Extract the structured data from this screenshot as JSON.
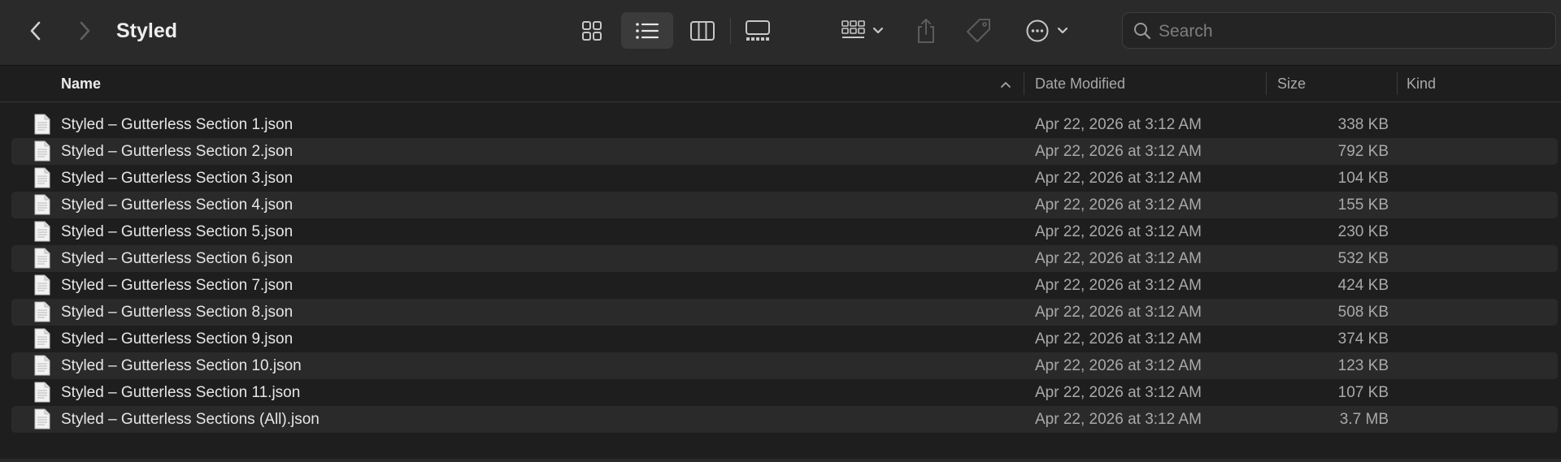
{
  "window": {
    "title": "Styled"
  },
  "toolbar": {
    "icons": {
      "back": "chevron-left-icon",
      "forward": "chevron-right-icon",
      "view_icons": "grid-icon",
      "view_list": "list-icon",
      "view_columns": "columns-icon",
      "view_gallery": "gallery-icon",
      "group": "group-icon",
      "share": "share-icon",
      "tag": "tag-icon",
      "more": "ellipsis-circle-icon",
      "search": "search-icon"
    },
    "search_placeholder": "Search",
    "search_value": ""
  },
  "columns": {
    "name": "Name",
    "date": "Date Modified",
    "size": "Size",
    "kind": "Kind"
  },
  "files": [
    {
      "name": "Styled – Gutterless Section 1.json",
      "date": "Apr 22, 2026 at 3:12 AM",
      "size": "338 KB",
      "kind": ""
    },
    {
      "name": "Styled – Gutterless Section 2.json",
      "date": "Apr 22, 2026 at 3:12 AM",
      "size": "792 KB",
      "kind": ""
    },
    {
      "name": "Styled – Gutterless Section 3.json",
      "date": "Apr 22, 2026 at 3:12 AM",
      "size": "104 KB",
      "kind": ""
    },
    {
      "name": "Styled – Gutterless Section 4.json",
      "date": "Apr 22, 2026 at 3:12 AM",
      "size": "155 KB",
      "kind": ""
    },
    {
      "name": "Styled – Gutterless Section 5.json",
      "date": "Apr 22, 2026 at 3:12 AM",
      "size": "230 KB",
      "kind": ""
    },
    {
      "name": "Styled – Gutterless Section 6.json",
      "date": "Apr 22, 2026 at 3:12 AM",
      "size": "532 KB",
      "kind": ""
    },
    {
      "name": "Styled – Gutterless Section 7.json",
      "date": "Apr 22, 2026 at 3:12 AM",
      "size": "424 KB",
      "kind": ""
    },
    {
      "name": "Styled – Gutterless Section 8.json",
      "date": "Apr 22, 2026 at 3:12 AM",
      "size": "508 KB",
      "kind": ""
    },
    {
      "name": "Styled – Gutterless Section 9.json",
      "date": "Apr 22, 2026 at 3:12 AM",
      "size": "374 KB",
      "kind": ""
    },
    {
      "name": "Styled – Gutterless Section 10.json",
      "date": "Apr 22, 2026 at 3:12 AM",
      "size": "123 KB",
      "kind": ""
    },
    {
      "name": "Styled – Gutterless Section 11.json",
      "date": "Apr 22, 2026 at 3:12 AM",
      "size": "107 KB",
      "kind": ""
    },
    {
      "name": "Styled – Gutterless Sections (All).json",
      "date": "Apr 22, 2026 at 3:12 AM",
      "size": "3.7 MB",
      "kind": ""
    }
  ]
}
